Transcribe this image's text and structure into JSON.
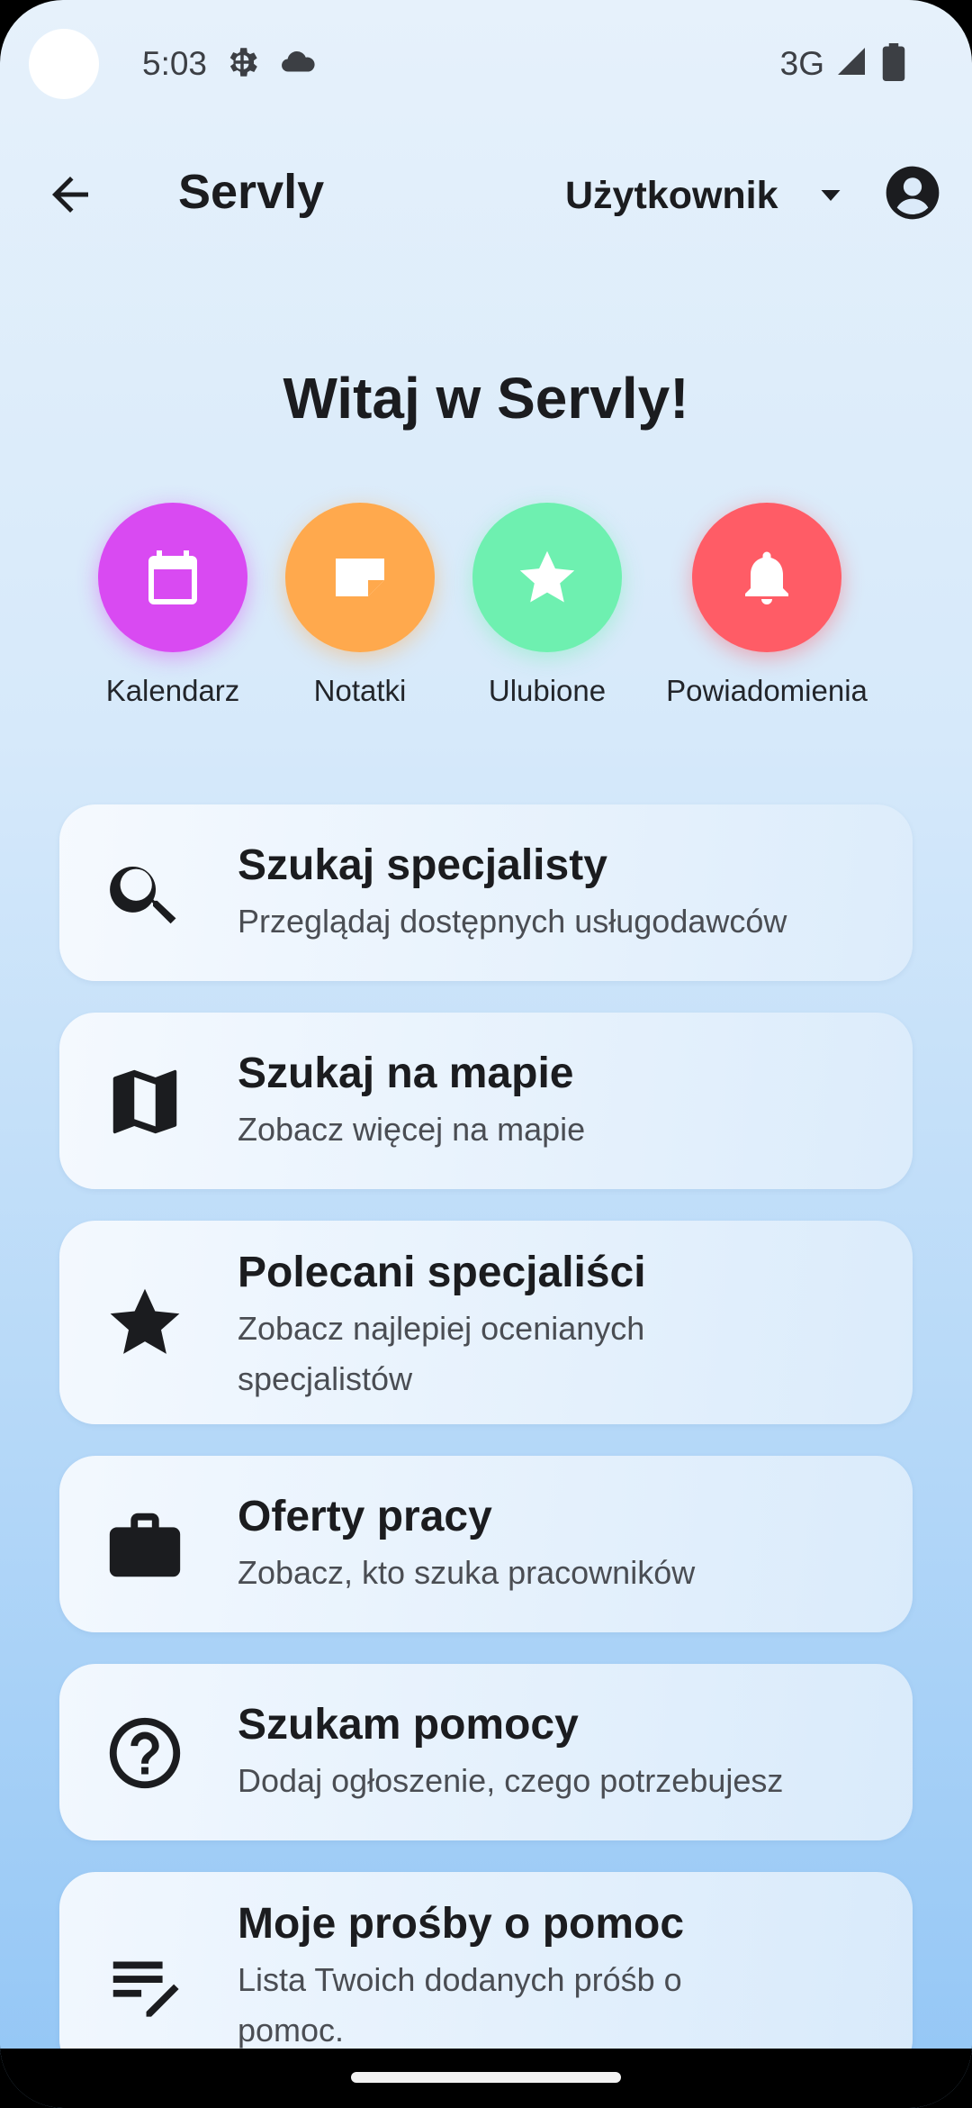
{
  "status_bar": {
    "time": "5:03",
    "network": "3G"
  },
  "app_bar": {
    "title": "Servly",
    "user_menu_label": "Użytkownik"
  },
  "welcome": "Witaj w Servly!",
  "quick_actions": [
    {
      "label": "Kalendarz",
      "icon": "calendar-icon",
      "color": "#d94af2"
    },
    {
      "label": "Notatki",
      "icon": "note-icon",
      "color": "#ffa94d"
    },
    {
      "label": "Ulubione",
      "icon": "star-icon",
      "color": "#6ef0b0"
    },
    {
      "label": "Powiadomienia",
      "icon": "bell-icon",
      "color": "#ff5c66"
    }
  ],
  "cards": [
    {
      "title": "Szukaj specjalisty",
      "subtitle": "Przeglądaj dostępnych usługodawców",
      "icon": "search-icon"
    },
    {
      "title": "Szukaj na mapie",
      "subtitle": "Zobacz więcej na mapie",
      "icon": "map-icon"
    },
    {
      "title": "Polecani specjaliści",
      "subtitle": "Zobacz najlepiej ocenianych specjalistów",
      "icon": "star-icon"
    },
    {
      "title": "Oferty pracy",
      "subtitle": "Zobacz, kto szuka pracowników",
      "icon": "briefcase-icon"
    },
    {
      "title": "Szukam pomocy",
      "subtitle": "Dodaj ogłoszenie, czego potrzebujesz",
      "icon": "help-icon"
    },
    {
      "title": "Moje prośby o pomoc",
      "subtitle": "Lista Twoich dodanych próśb o pomoc.",
      "icon": "edit-list-icon"
    }
  ]
}
